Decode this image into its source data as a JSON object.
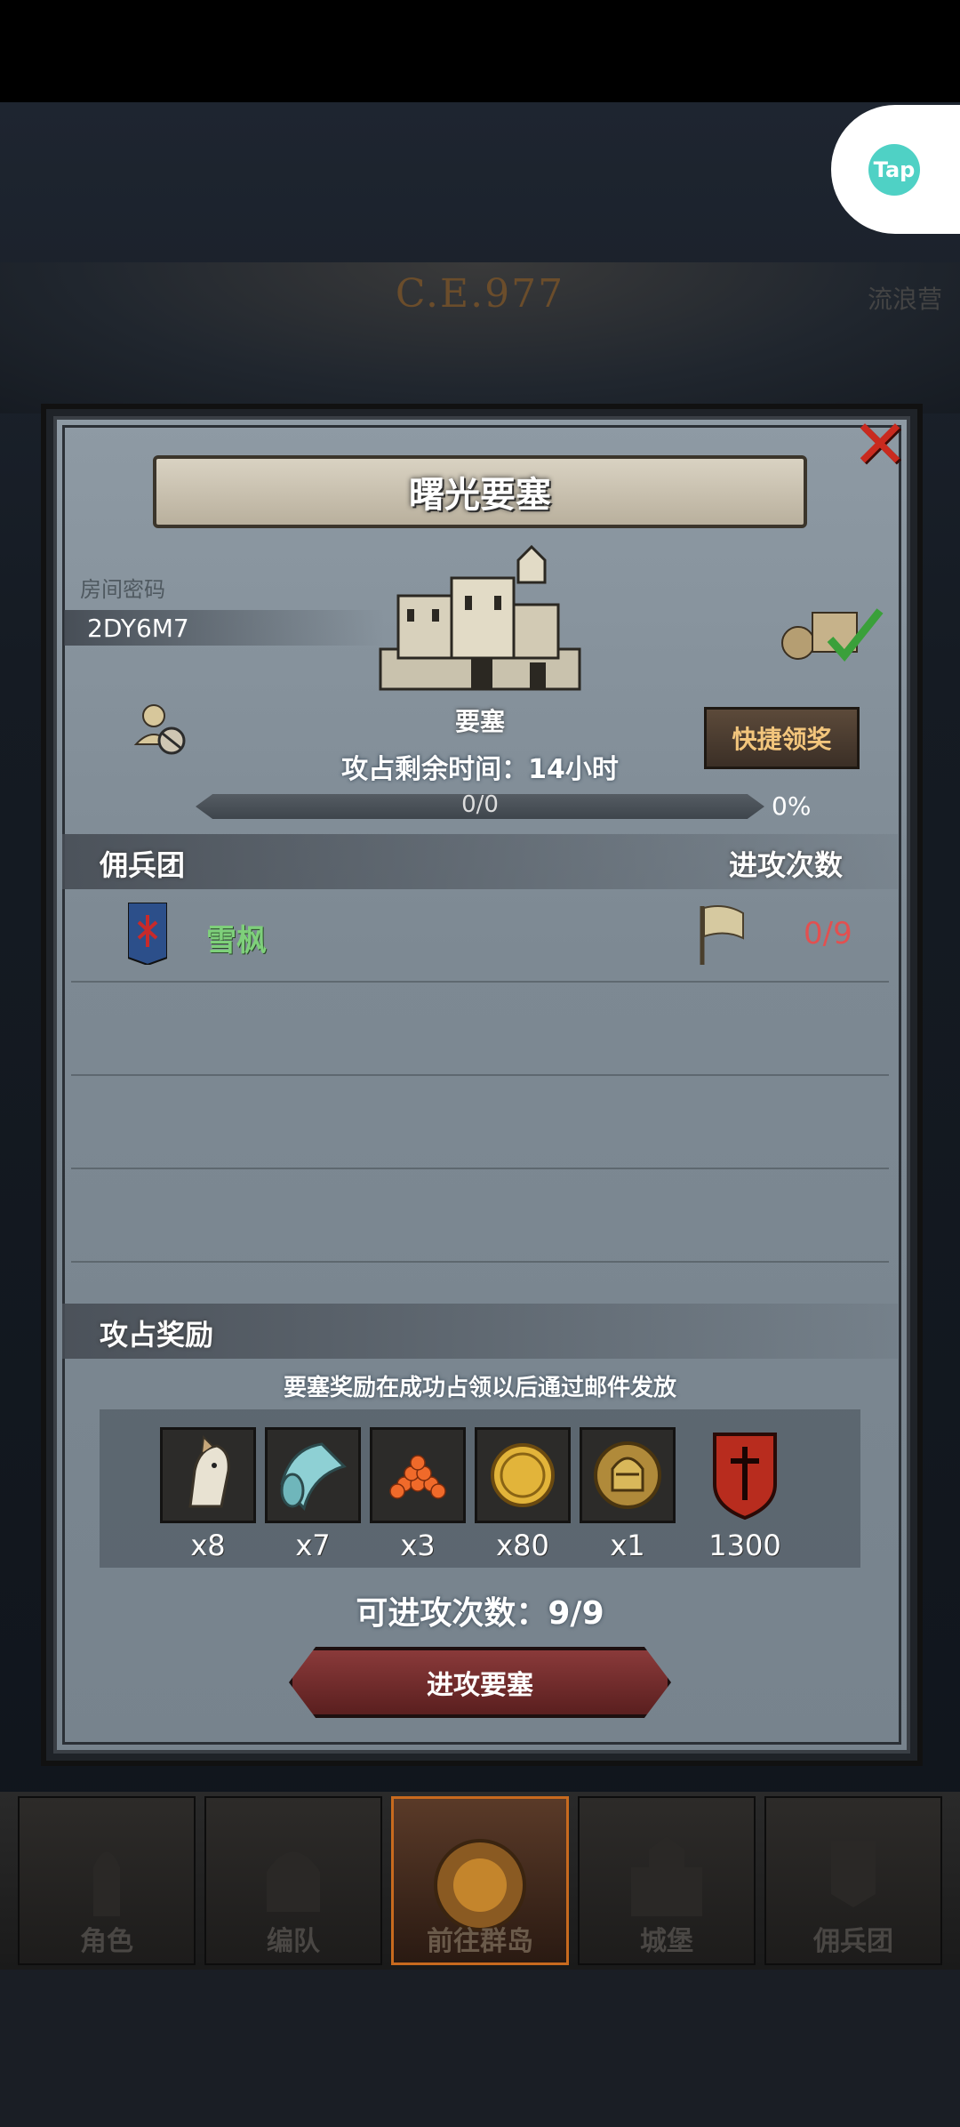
{
  "header": {
    "year_badge": "C.E.977",
    "top_right_label": "流浪营"
  },
  "tap": {
    "logo_text": "Tap"
  },
  "dialog": {
    "title": "曙光要塞",
    "close_symbol": "✕",
    "room_password_label": "房间密码",
    "room_password_value": "2DY6M7",
    "fortress_label": "要塞",
    "quick_claim_label": "快捷领奖",
    "time_remaining": "攻占剩余时间：14小时",
    "progress_text": "0/0",
    "progress_percent": "0%",
    "progress_fraction": 0,
    "mercenary_header": "佣兵团",
    "attack_count_header": "进攻次数",
    "guild": {
      "name": "雪枫",
      "attack_count": "0/9"
    },
    "reward_header": "攻占奖励",
    "reward_note": "要塞奖励在成功占领以后通过邮件发放",
    "rewards": [
      {
        "icon": "horse-icon",
        "qty": "x8"
      },
      {
        "icon": "cloth-icon",
        "qty": "x7"
      },
      {
        "icon": "caviar-icon",
        "qty": "x3"
      },
      {
        "icon": "gold-coin-icon",
        "qty": "x80"
      },
      {
        "icon": "knight-helmet-coin-icon",
        "qty": "x1"
      },
      {
        "icon": "red-shield-icon",
        "qty": "1300"
      }
    ],
    "attempts": "可进攻次数：9/9",
    "attack_button": "进攻要塞"
  },
  "nav": {
    "items": [
      {
        "label": "角色"
      },
      {
        "label": "编队"
      },
      {
        "label": "前往群岛"
      },
      {
        "label": "城堡"
      },
      {
        "label": "佣兵团"
      }
    ],
    "active_index": 2
  },
  "colors": {
    "accent_green": "#7ed07a",
    "count_red": "#e25050",
    "close_red": "#c92a1f",
    "claim_gold": "#f2c57c"
  }
}
